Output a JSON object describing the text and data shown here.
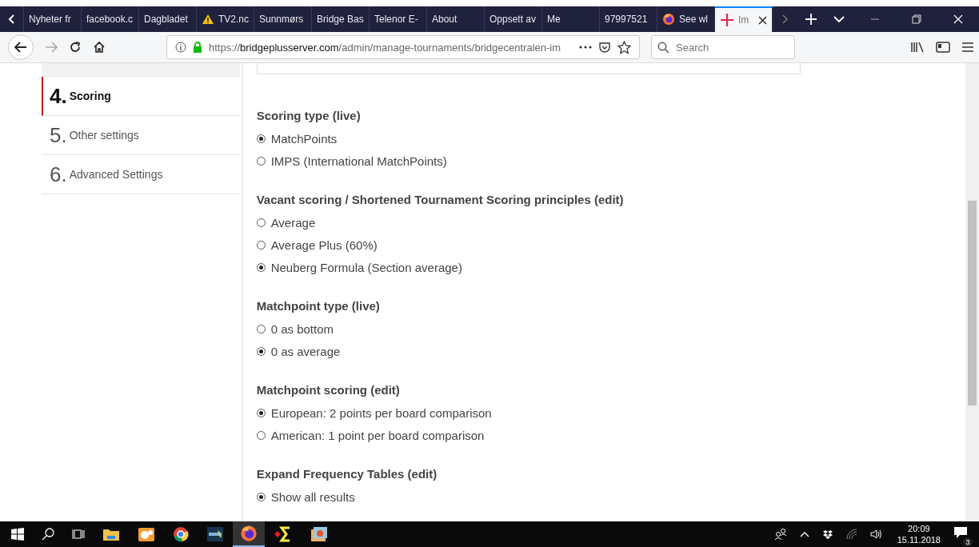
{
  "browser": {
    "tabs": [
      {
        "label": "Nyheter fr",
        "kind": "plain",
        "selected": false
      },
      {
        "label": "facebook.c",
        "kind": "plain",
        "selected": false
      },
      {
        "label": "Dagbladet",
        "kind": "plain",
        "selected": false
      },
      {
        "label": "TV2.nc",
        "kind": "warning",
        "selected": false
      },
      {
        "label": "Sunnmørs",
        "kind": "plain",
        "selected": false
      },
      {
        "label": "Bridge Bas",
        "kind": "plain",
        "selected": false
      },
      {
        "label": "Telenor E-",
        "kind": "plain",
        "selected": false
      },
      {
        "label": "About",
        "kind": "plain",
        "selected": false
      },
      {
        "label": "Oppsett av",
        "kind": "plain",
        "selected": false
      },
      {
        "label": "Me",
        "kind": "plain",
        "selected": false
      },
      {
        "label": "97997521",
        "kind": "plain",
        "selected": false
      },
      {
        "label": "See wl",
        "kind": "firefox",
        "selected": false
      },
      {
        "label": "Im",
        "kind": "plus",
        "selected": true
      }
    ],
    "url": {
      "scheme": "https://",
      "host": "bridgeplusserver.com",
      "path": "/admin/manage-tournaments/bridgecentralen-im"
    },
    "search": {
      "placeholder": "Search"
    }
  },
  "sidebar": {
    "steps": [
      {
        "number": "4.",
        "label": "Scoring",
        "selected": true
      },
      {
        "number": "5.",
        "label": "Other settings",
        "selected": false
      },
      {
        "number": "6.",
        "label": "Advanced Settings",
        "selected": false
      }
    ]
  },
  "sections": [
    {
      "title": "Scoring type (live)",
      "options": [
        {
          "label": "MatchPoints",
          "selected": true
        },
        {
          "label": "IMPS (International MatchPoints)",
          "selected": false
        }
      ]
    },
    {
      "title": "Vacant scoring / Shortened Tournament Scoring principles (edit)",
      "options": [
        {
          "label": "Average",
          "selected": false
        },
        {
          "label": "Average Plus (60%)",
          "selected": false
        },
        {
          "label": "Neuberg Formula (Section average)",
          "selected": true
        }
      ]
    },
    {
      "title": "Matchpoint type (live)",
      "options": [
        {
          "label": "0 as bottom",
          "selected": false
        },
        {
          "label": "0 as average",
          "selected": true
        }
      ]
    },
    {
      "title": "Matchpoint scoring (edit)",
      "options": [
        {
          "label": "European: 2 points per board comparison",
          "selected": true
        },
        {
          "label": "American: 1 point per board comparison",
          "selected": false
        }
      ]
    },
    {
      "title": "Expand Frequency Tables (edit)",
      "options": [
        {
          "label": "Show all results",
          "selected": true
        }
      ]
    }
  ],
  "taskbar": {
    "time": "20:09",
    "date": "15.11.2018",
    "notifications": "3"
  }
}
